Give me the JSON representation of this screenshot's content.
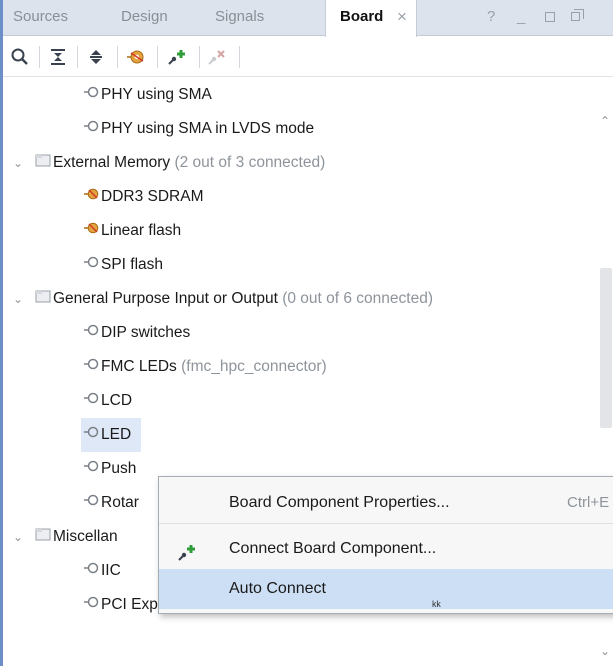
{
  "tabs": [
    {
      "label": "Sources"
    },
    {
      "label": "Design"
    },
    {
      "label": "Signals"
    },
    {
      "label": "Board"
    }
  ],
  "window_controls": {
    "help": "?",
    "minimize": "_"
  },
  "toolbar_icons": [
    "search-icon",
    "collapse-all-icon",
    "expand-all-icon",
    "board-part-icon",
    "connect-icon",
    "disconnect-icon"
  ],
  "tree": [
    {
      "type": "item",
      "label": "PHY using SMA"
    },
    {
      "type": "item",
      "label": "PHY using SMA in LVDS mode"
    },
    {
      "type": "group",
      "label": "External Memory",
      "count": "(2 out of 3 connected)"
    },
    {
      "type": "item",
      "label": "DDR3 SDRAM",
      "connected": true
    },
    {
      "type": "item",
      "label": "Linear flash",
      "connected": true
    },
    {
      "type": "item",
      "label": "SPI flash"
    },
    {
      "type": "group",
      "label": "General Purpose Input or Output",
      "count": "(0 out of 6 connected)"
    },
    {
      "type": "item",
      "label": "DIP switches"
    },
    {
      "type": "item",
      "label": "FMC LEDs",
      "sub": "(fmc_hpc_connector)"
    },
    {
      "type": "item",
      "label": "LCD"
    },
    {
      "type": "item",
      "label": "LED",
      "selected": true
    },
    {
      "type": "item",
      "label": "Push"
    },
    {
      "type": "item",
      "label": "Rotar"
    },
    {
      "type": "group",
      "label": "Miscellan"
    },
    {
      "type": "item",
      "label": "IIC"
    },
    {
      "type": "item",
      "label": "PCI Express"
    }
  ],
  "context_menu": {
    "properties": {
      "label": "Board Component Properties...",
      "shortcut": "Ctrl+E"
    },
    "connect": {
      "label": "Connect Board Component..."
    },
    "auto_connect": {
      "label": "Auto Connect"
    }
  },
  "colors": {
    "accent": "#6d8fc7",
    "highlight": "#cddff5",
    "muted": "#8e949b",
    "connect_green": "#2e9d3a"
  }
}
